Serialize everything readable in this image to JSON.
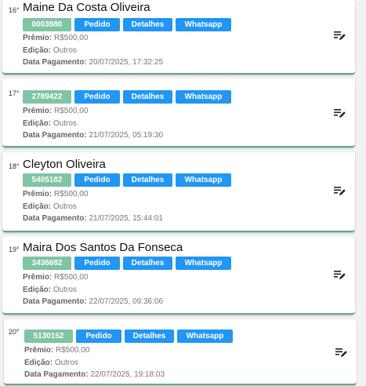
{
  "labels": {
    "premio": "Prêmio:",
    "edicao": "Edição:",
    "data_pagamento": "Data Pagamento:"
  },
  "buttons": {
    "pedido": "Pedido",
    "detalhes": "Detalhes",
    "whatsapp": "Whatsapp"
  },
  "cards": [
    {
      "rank": "16°",
      "name": "Maine Da Costa Oliveira",
      "code": "0003980",
      "premio": "R$500,00",
      "edicao": "Outros",
      "data_pagamento": "20/07/2025, 17:32:25"
    },
    {
      "rank": "17°",
      "name": "",
      "code": "2789422",
      "premio": "R$500,00",
      "edicao": "Outros",
      "data_pagamento": "21/07/2025, 05:19:30"
    },
    {
      "rank": "18°",
      "name": "Cleyton Oliveira",
      "code": "5405182",
      "premio": "R$500,00",
      "edicao": "Outros",
      "data_pagamento": "21/07/2025, 15:44:01"
    },
    {
      "rank": "19°",
      "name": "Maira Dos Santos Da Fonseca",
      "code": "3436682",
      "premio": "R$500,00",
      "edicao": "Outros",
      "data_pagamento": "22/07/2025, 09:36:06"
    },
    {
      "rank": "20°",
      "name": "",
      "code": "5130152",
      "premio": "R$500,00",
      "edicao": "Outros",
      "data_pagamento": "22/07/2025, 19:18:03"
    }
  ],
  "icons": {
    "edit": "edit-note-icon"
  },
  "colors": {
    "code_badge": "#7fc4a3",
    "button": "#2196f3",
    "card_border": "#5fa886"
  }
}
